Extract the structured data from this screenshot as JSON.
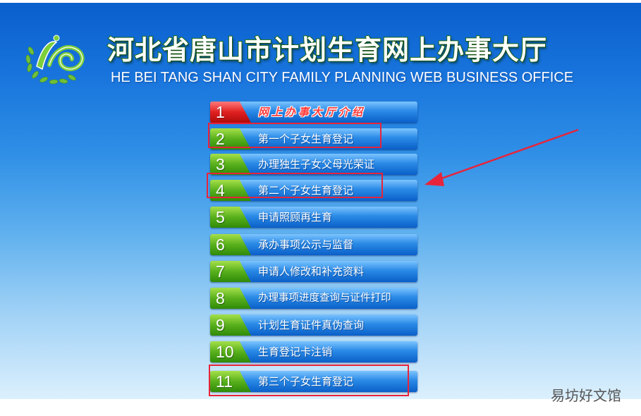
{
  "header": {
    "title_cn": "河北省唐山市计划生育网上办事大厅",
    "title_en": "HE BEI TANG SHAN CITY FAMILY PLANNING WEB BUSINESS OFFICE"
  },
  "menu": {
    "items": [
      {
        "num": "1",
        "label": "网上办事大厅介绍"
      },
      {
        "num": "2",
        "label": "第一个子女生育登记"
      },
      {
        "num": "3",
        "label": "办理独生子女父母光荣证"
      },
      {
        "num": "4",
        "label": "第二个子女生育登记"
      },
      {
        "num": "5",
        "label": "申请照顾再生育"
      },
      {
        "num": "6",
        "label": "承办事项公示与监督"
      },
      {
        "num": "7",
        "label": "申请人修改和补充资料"
      },
      {
        "num": "8",
        "label": "办理事项进度查询与证件打印"
      },
      {
        "num": "9",
        "label": "计划生育证件真伪查询"
      },
      {
        "num": "10",
        "label": "生育登记卡注销"
      },
      {
        "num": "11",
        "label": "第三个子女生育登记"
      }
    ]
  },
  "colors": {
    "highlight": "#e8243a",
    "number_green": "#58b01c",
    "number_red": "#e02020",
    "button_blue": "#2a8ae6"
  },
  "watermark": "易坊好文馆"
}
